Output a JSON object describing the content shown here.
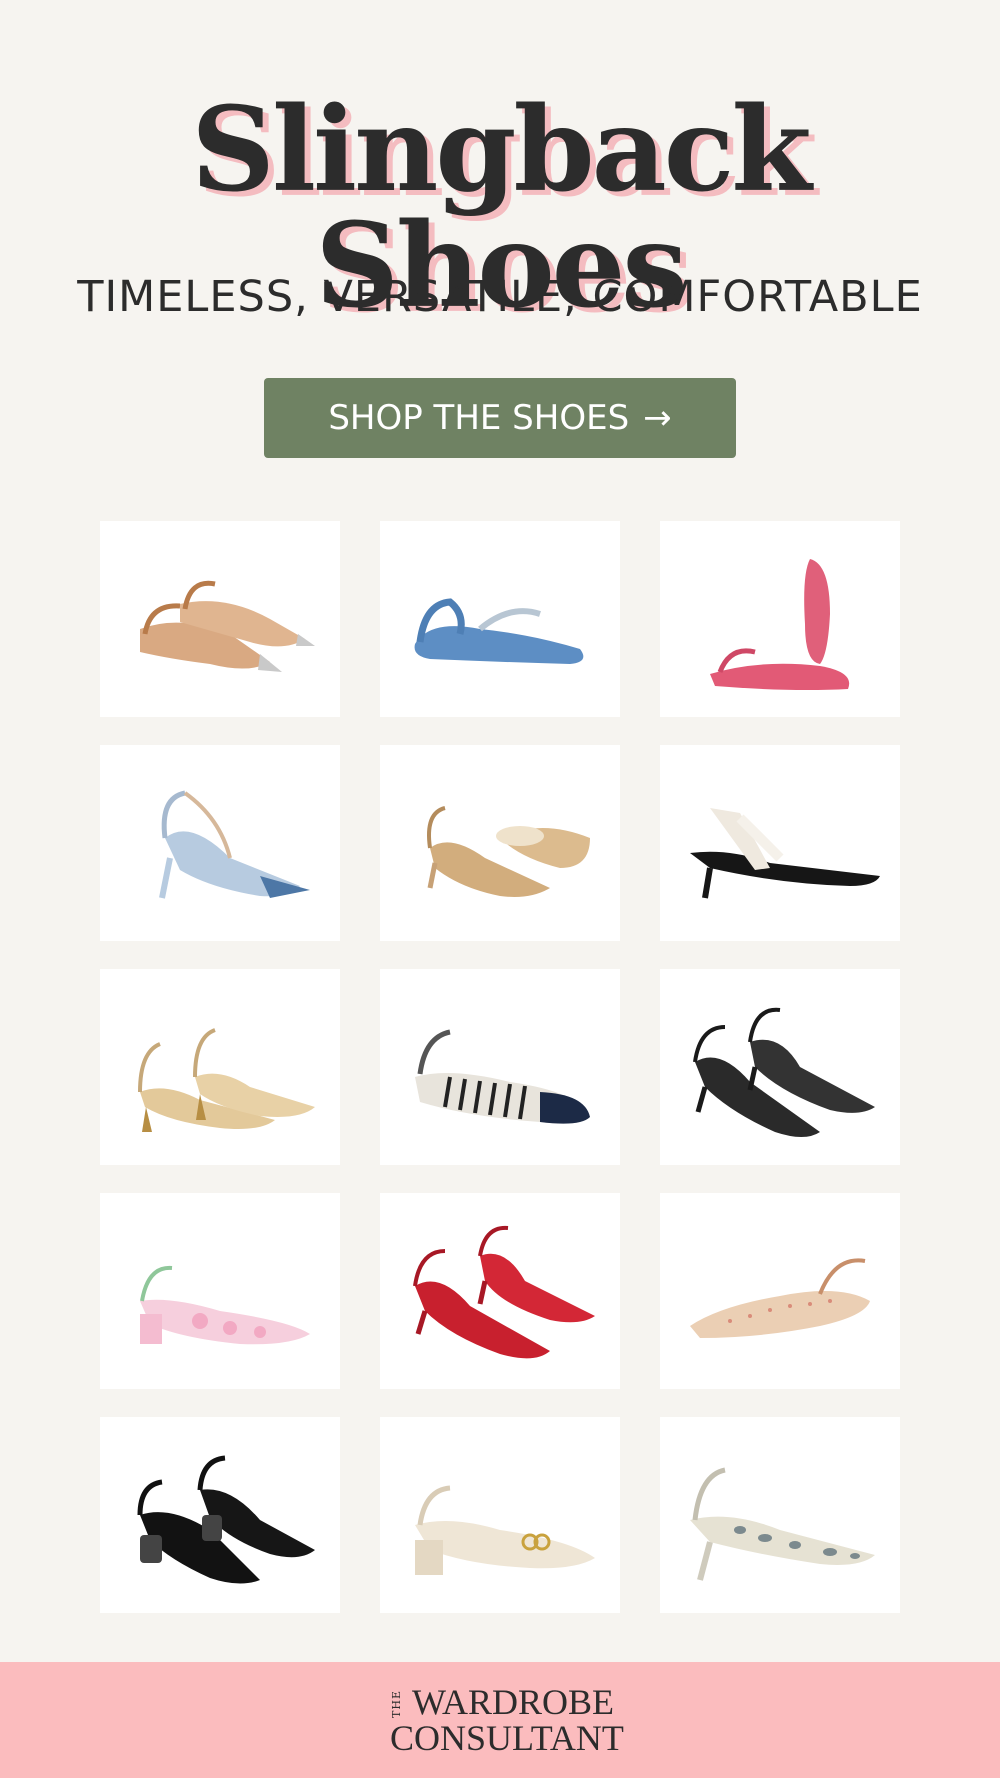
{
  "header": {
    "title": "Slingback Shoes",
    "subtitle": "TIMELESS, VERSATILE, COMFORTABLE"
  },
  "cta": {
    "label": "SHOP THE SHOES",
    "arrow": "→"
  },
  "colors": {
    "background": "#f6f4f0",
    "title": "#2c2c2c",
    "title_shadow": "#f4bcc0",
    "cta": "#6f8263",
    "footer": "#fbbcbe"
  },
  "products": [
    {
      "icon": "mesh-pointed-flat-slingback-icon"
    },
    {
      "icon": "denim-flat-slingback-icon"
    },
    {
      "icon": "pink-flat-slingback-icon"
    },
    {
      "icon": "light-blue-kitten-heel-slingback-icon"
    },
    {
      "icon": "raffia-kitten-heel-slingback-icon"
    },
    {
      "icon": "black-kitten-heel-ribbon-slingback-icon"
    },
    {
      "icon": "raffia-flared-heel-slingback-icon"
    },
    {
      "icon": "striped-square-toe-flat-slingback-icon"
    },
    {
      "icon": "black-mesh-kitten-heel-slingback-icon"
    },
    {
      "icon": "pink-floral-block-heel-slingback-icon"
    },
    {
      "icon": "red-mesh-kitten-heel-slingback-icon"
    },
    {
      "icon": "tweed-flat-slingback-icon"
    },
    {
      "icon": "black-embellished-heel-slingback-icon"
    },
    {
      "icon": "cream-block-heel-slingback-icon"
    },
    {
      "icon": "snakeskin-heel-slingback-icon"
    }
  ],
  "footer": {
    "logo_the": "THE",
    "logo_line1": "WARDROBE",
    "logo_line2": "CONSULTANT"
  }
}
